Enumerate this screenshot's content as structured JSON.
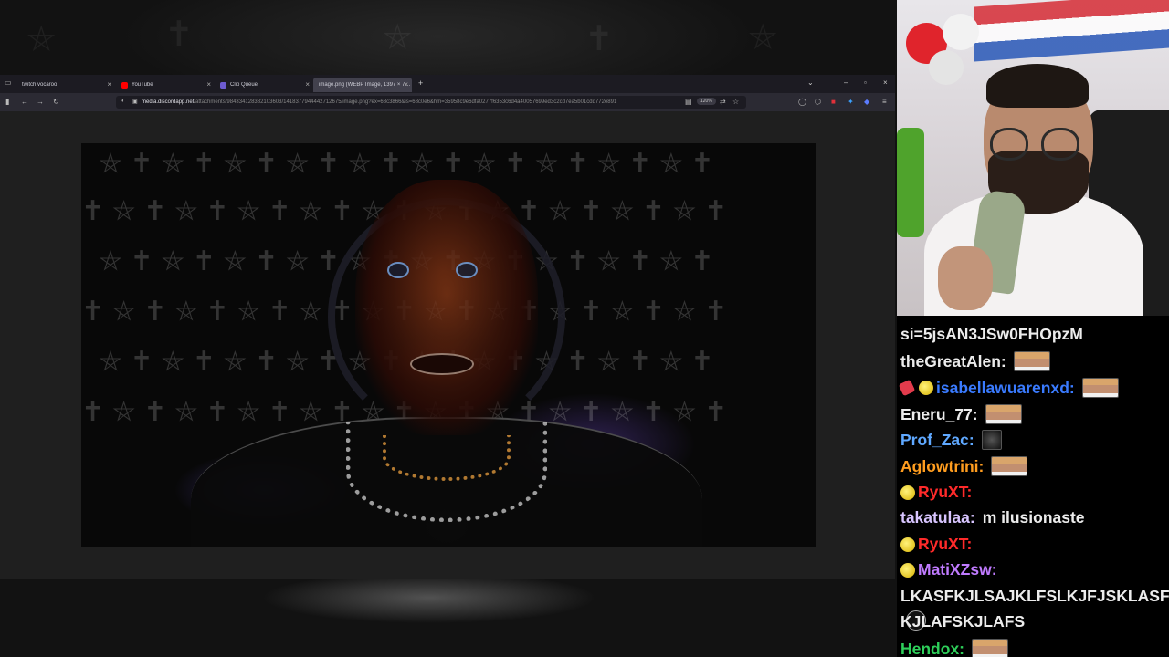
{
  "browser": {
    "tabs": [
      {
        "title": "twitch vocaroo",
        "active": false,
        "favicon_color": "#9b9b9b"
      },
      {
        "title": "YouTube",
        "active": false,
        "favicon_color": "#ff0000"
      },
      {
        "title": "Clip Queue",
        "active": false,
        "favicon_color": "#6d5bd0"
      },
      {
        "title": "image.png (WEBP Image, 1397 × 7…",
        "active": true,
        "favicon_color": ""
      }
    ],
    "new_tab_label": "+",
    "url_domain": "media.discordapp.net",
    "url_path": "/attachments/984334128382103603/1418377944442712675/image.png?ex=68c3866&is=68c0e6&hm=35958c9e6dfa0277f6353c6d4a40057699ed3c2cd7ea5b01cdd772e891",
    "zoom": "120%"
  },
  "webcam": {
    "icon": "streamer-camera"
  },
  "chat": {
    "messages": [
      {
        "user": "",
        "text": "si=5jsAN3JSw0FHOpzM",
        "color": "#ececec",
        "badges": [],
        "emote": ""
      },
      {
        "user": "theGreatAlen:",
        "text": "",
        "color": "#ececec",
        "badges": [],
        "emote": "face"
      },
      {
        "user": "isabellawuarenxd:",
        "text": "",
        "color": "#3a7bff",
        "badges": [
          "pin",
          "cheer"
        ],
        "emote": "face"
      },
      {
        "user": "Eneru_77:",
        "text": "",
        "color": "#ececec",
        "badges": [],
        "emote": "face"
      },
      {
        "user": "Prof_Zac:",
        "text": "",
        "color": "#5fa8ff",
        "badges": [],
        "emote": "dark"
      },
      {
        "user": "Aglowtrini:",
        "text": "",
        "color": "#ff9d1f",
        "badges": [],
        "emote": "face"
      },
      {
        "user": "RyuXT:",
        "text": "",
        "color": "#ff2a2a",
        "badges": [
          "cheer"
        ],
        "emote": "glasses"
      },
      {
        "user": "takatulaa:",
        "text": "m ilusionaste",
        "color": "#d8c5ff",
        "badges": [],
        "emote": ""
      },
      {
        "user": "RyuXT:",
        "text": "",
        "color": "#ff2a2a",
        "badges": [
          "cheer"
        ],
        "emote": "glasses"
      },
      {
        "user": "MatiXZsw:",
        "text": "",
        "color": "#c07bff",
        "badges": [
          "cheer"
        ],
        "emote": ""
      },
      {
        "user": "",
        "text": "LKASFKJLSAJKLFSLKJFJSKLASFKLJ",
        "color": "#ececec",
        "badges": [],
        "emote": ""
      },
      {
        "user": "",
        "text": "KJLAFSKJLAFS",
        "color": "#ececec",
        "badges": [],
        "emote": ""
      },
      {
        "user": "Hendox:",
        "text": "",
        "color": "#2ecf5a",
        "badges": [],
        "emote": "face"
      }
    ]
  }
}
